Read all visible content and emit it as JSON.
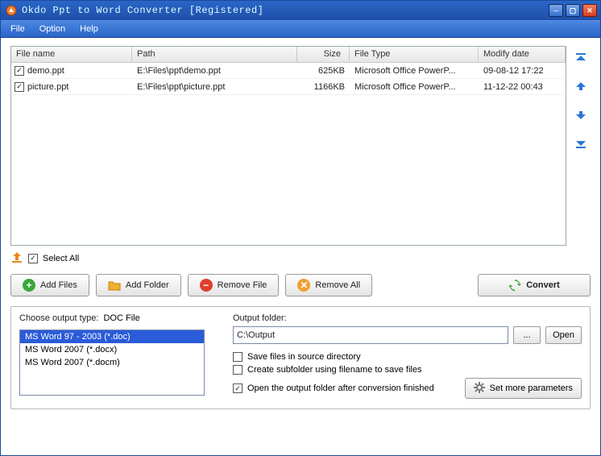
{
  "window": {
    "title": "Okdo Ppt to Word Converter [Registered]"
  },
  "menu": {
    "file": "File",
    "option": "Option",
    "help": "Help"
  },
  "table": {
    "headers": {
      "name": "File name",
      "path": "Path",
      "size": "Size",
      "type": "File Type",
      "date": "Modify date"
    },
    "rows": [
      {
        "checked": true,
        "name": "demo.ppt",
        "path": "E:\\Files\\ppt\\demo.ppt",
        "size": "625KB",
        "type": "Microsoft Office PowerP...",
        "date": "09-08-12 17:22"
      },
      {
        "checked": true,
        "name": "picture.ppt",
        "path": "E:\\Files\\ppt\\picture.ppt",
        "size": "1166KB",
        "type": "Microsoft Office PowerP...",
        "date": "11-12-22 00:43"
      }
    ]
  },
  "selectAll": {
    "label": "Select All",
    "checked": true
  },
  "buttons": {
    "addFiles": "Add Files",
    "addFolder": "Add Folder",
    "removeFile": "Remove File",
    "removeAll": "Remove All",
    "convert": "Convert"
  },
  "output": {
    "chooseTypeLabel": "Choose output type:",
    "chooseTypeValue": "DOC File",
    "types": [
      "MS Word 97 - 2003 (*.doc)",
      "MS Word 2007 (*.docx)",
      "MS Word 2007 (*.docm)"
    ],
    "selectedTypeIndex": 0,
    "folderLabel": "Output folder:",
    "folderValue": "C:\\Output",
    "browse": "...",
    "open": "Open",
    "saveInSource": {
      "label": "Save files in source directory",
      "checked": false
    },
    "createSubfolder": {
      "label": "Create subfolder using filename to save files",
      "checked": false
    },
    "openAfter": {
      "label": "Open the output folder after conversion finished",
      "checked": true
    },
    "setMoreParams": "Set more parameters"
  }
}
